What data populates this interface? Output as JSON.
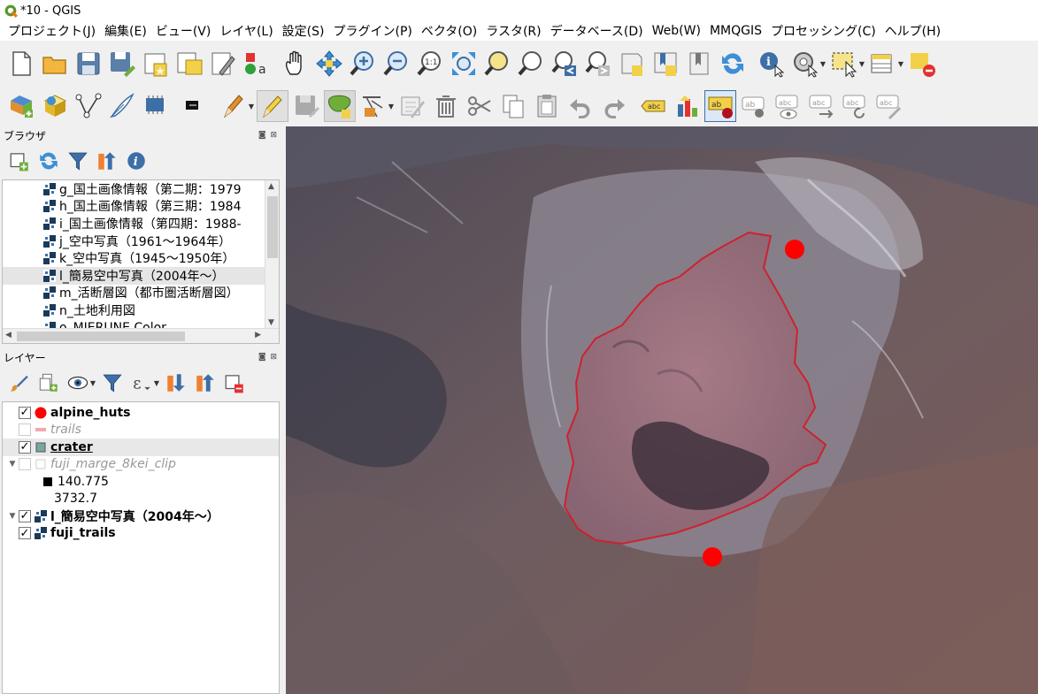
{
  "window": {
    "title": "*10 - QGIS"
  },
  "menu": [
    "プロジェクト(J)",
    "編集(E)",
    "ビュー(V)",
    "レイヤ(L)",
    "設定(S)",
    "プラグイン(P)",
    "ベクタ(O)",
    "ラスタ(R)",
    "データベース(D)",
    "Web(W)",
    "MMQGIS",
    "プロセッシング(C)",
    "ヘルプ(H)"
  ],
  "browser": {
    "title": "ブラウザ",
    "controls": "◙ ⊠",
    "items": [
      {
        "label": "g_国土画像情報（第二期：1979"
      },
      {
        "label": "h_国土画像情報（第三期：1984"
      },
      {
        "label": "i_国土画像情報（第四期：1988-"
      },
      {
        "label": "j_空中写真（1961〜1964年）"
      },
      {
        "label": "k_空中写真（1945〜1950年）"
      },
      {
        "label": "l_簡易空中写真（2004年〜）"
      },
      {
        "label": "m_活断層図（都市圏活断層図）"
      },
      {
        "label": "n_土地利用図"
      },
      {
        "label": "o_MIERUNE Color"
      }
    ]
  },
  "layers": {
    "title": "レイヤー",
    "controls": "◙ ⊠",
    "items": [
      {
        "name": "alpine_huts",
        "checked": "✓"
      },
      {
        "name": "trails",
        "checked": ""
      },
      {
        "name": "crater",
        "checked": "✓"
      },
      {
        "name": "fuji_marge_8kei_clip",
        "checked": ""
      },
      {
        "legend_max": "140.775"
      },
      {
        "legend_min": "3732.7"
      },
      {
        "name": "l_簡易空中写真（2004年〜）",
        "checked": "✓"
      },
      {
        "name": "fuji_trails",
        "checked": "✓"
      }
    ]
  },
  "colors": {
    "hut_marker": "#ff0000",
    "crater_outline": "#d21e2a",
    "crater_fill": "#b4788a"
  },
  "icons": {
    "toolbar1": [
      "new-project-icon",
      "open-project-icon",
      "save-project-icon",
      "save-as-icon",
      "print-layout-icon",
      "layout-manager-icon",
      "style-manager-icon",
      "pan-icon",
      "pan-to-selection-icon",
      "zoom-in-icon",
      "zoom-out-icon",
      "zoom-native-icon",
      "zoom-full-icon",
      "zoom-to-selection-icon",
      "zoom-to-layer-icon",
      "zoom-last-icon",
      "zoom-next-icon",
      "new-bookmark-icon",
      "show-bookmarks-icon",
      "spatial-bookmark-icon",
      "refresh-icon",
      "identify-icon",
      "action-icon",
      "select-features-icon",
      "attribute-table-icon",
      "deselect-icon"
    ],
    "toolbar2": [
      "data-source-manager-icon",
      "new-geopackage-icon",
      "digitize-icon",
      "new-temp-layer-icon",
      "new-virtual-layer-icon",
      "new-3d-icon",
      "current-edits-icon",
      "toggle-editing-icon",
      "save-edits-icon",
      "add-feature-icon",
      "vertex-tool-icon",
      "modify-attributes-icon",
      "delete-icon",
      "cut-icon",
      "copy-icon",
      "paste-icon",
      "undo-icon",
      "redo-icon",
      "label-toolbar-icon",
      "diagram-icon",
      "highlight-labels-icon",
      "pin-label-icon",
      "show-hide-labels-icon",
      "move-label-icon",
      "rotate-label-icon",
      "change-label-icon"
    ]
  }
}
